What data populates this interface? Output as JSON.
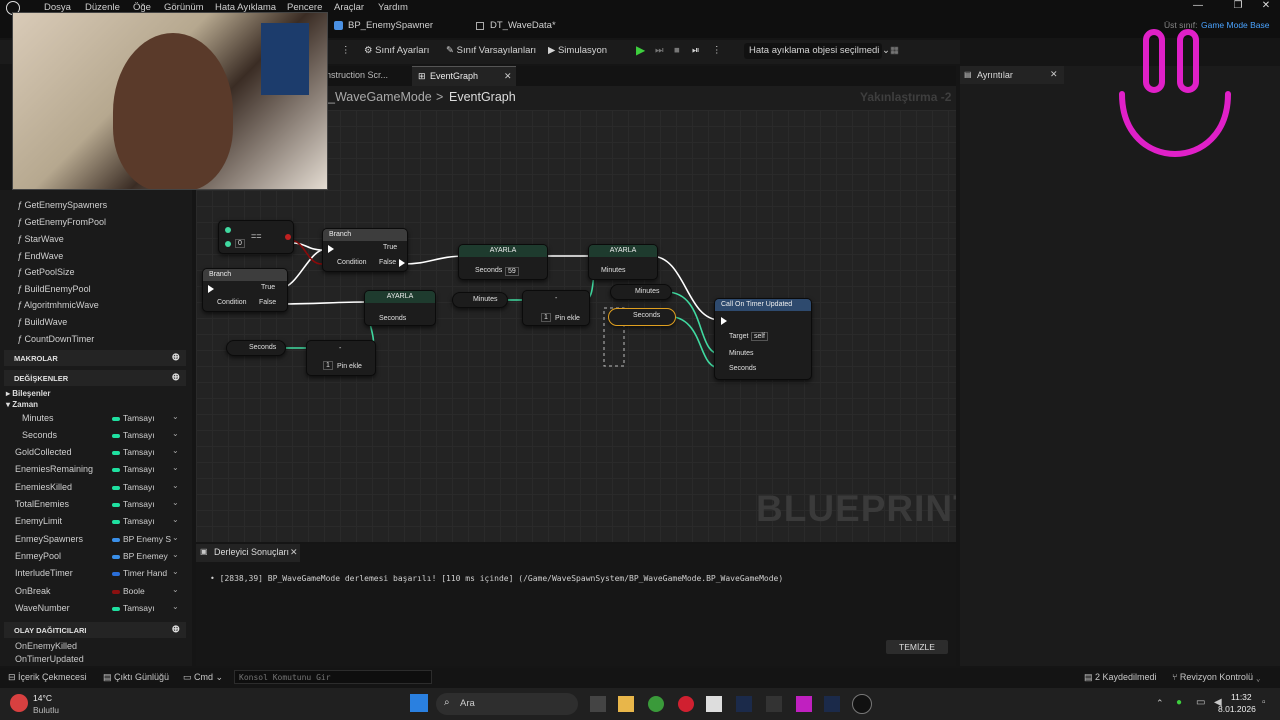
{
  "menu": [
    "Dosya",
    "Düzenle",
    "Öğe",
    "Görünüm",
    "Hata Ayıklama",
    "Pencere",
    "Araçlar",
    "Yardım"
  ],
  "doc_tabs": [
    "BP_EnemySpawner",
    "DT_WaveData*"
  ],
  "parent_class": {
    "label": "Üst sınıf:",
    "value": "Game Mode Base"
  },
  "toolbar": {
    "class_settings": "Sınıf Ayarları",
    "class_defaults": "Sınıf Varsayılanları",
    "simulation": "Simulasyon",
    "debug_object": "Hata ayıklama objesi seçilmedi"
  },
  "graph_tabs": [
    "nstruction Scr...",
    "EventGraph"
  ],
  "breadcrumb": {
    "parent": "_WaveGameMode",
    "sep": ">",
    "current": "EventGraph"
  },
  "zoom_label": "Yakınlaştırma -2",
  "watermark": "BLUEPRINT",
  "details_tab": "Ayrıntılar",
  "functions": [
    "GetEnemySpawners",
    "GetEnemyFromPool",
    "StarWave",
    "EndWave",
    "GetPoolSize",
    "BuildEnemyPool",
    "AlgoritmhmicWave",
    "BuildWave",
    "CountDownTimer"
  ],
  "sections": {
    "macros": "MAKROLAR",
    "variables": "DEĞİŞKENLER",
    "dispatchers": "OLAY DAĞITICILARI"
  },
  "var_groups": {
    "components": "Bileşenler",
    "time": "Zaman"
  },
  "variables": [
    {
      "name": "Minutes",
      "type": "Tamsayı",
      "color": "#1fe0a0"
    },
    {
      "name": "Seconds",
      "type": "Tamsayı",
      "color": "#1fe0a0"
    },
    {
      "name": "GoldCollected",
      "type": "Tamsayı",
      "color": "#1fe0a0"
    },
    {
      "name": "EnemiesRemaining",
      "type": "Tamsayı",
      "color": "#1fe0a0"
    },
    {
      "name": "EnemiesKilled",
      "type": "Tamsayı",
      "color": "#1fe0a0"
    },
    {
      "name": "TotalEnemies",
      "type": "Tamsayı",
      "color": "#1fe0a0"
    },
    {
      "name": "EnemyLimit",
      "type": "Tamsayı",
      "color": "#1fe0a0"
    },
    {
      "name": "EnmeySpawners",
      "type": "BP Enemy S",
      "color": "#3a8fe8"
    },
    {
      "name": "EnmeyPool",
      "type": "BP Enemey",
      "color": "#3a8fe8"
    },
    {
      "name": "InterludeTimer",
      "type": "Timer Hand",
      "color": "#2a6ed8"
    },
    {
      "name": "OnBreak",
      "type": "Boole",
      "color": "#8a1010"
    },
    {
      "name": "WaveNumber",
      "type": "Tamsayı",
      "color": "#1fe0a0"
    }
  ],
  "dispatchers": [
    "OnEnemyKilled",
    "OnTimerUpdated"
  ],
  "nodes": {
    "branch1": {
      "title": "Branch",
      "true": "True",
      "false": "False",
      "cond": "Condition"
    },
    "branch2": {
      "title": "Branch",
      "true": "True",
      "false": "False",
      "cond": "Condition"
    },
    "eq": {
      "op": "==",
      "val": "0"
    },
    "set1": {
      "title": "AYARLA",
      "pin": "Seconds"
    },
    "set2": {
      "title": "AYARLA",
      "pin": "Seconds",
      "val": "59"
    },
    "set3": {
      "title": "AYARLA",
      "pin": "Minutes"
    },
    "get_seconds1": "Seconds",
    "get_minutes1": "Minutes",
    "get_minutes2": "Minutes",
    "get_seconds2": "Seconds",
    "minus1": {
      "sym": "-",
      "val": "1",
      "add": "Pin ekle"
    },
    "minus2": {
      "sym": "-",
      "val": "1",
      "add": "Pin ekle"
    },
    "call": {
      "title": "Call On Timer Updated",
      "target": "Target",
      "self": "self",
      "minutes": "Minutes",
      "seconds": "Seconds"
    }
  },
  "compiler": {
    "tab": "Derleyici Sonuçları",
    "message": "[2838,39] BP_WaveGameMode derlemesi başarılı! [110 ms içinde] (/Game/WaveSpawnSystem/BP_WaveGameMode.BP_WaveGameMode)",
    "clear": "TEMİZLE"
  },
  "status": {
    "content_drawer": "İçerik Çekmecesi",
    "output_log": "Çıktı Günlüğü",
    "cmd": "Cmd",
    "console_placeholder": "Konsol Komutunu Gir",
    "saved": "2 Kaydedilmedi",
    "revision": "Revizyon Kontrolü"
  },
  "taskbar": {
    "temp": "14°C",
    "weather": "Bulutlu",
    "search": "Ara",
    "time": "11:32",
    "date": "8.01.2026"
  }
}
